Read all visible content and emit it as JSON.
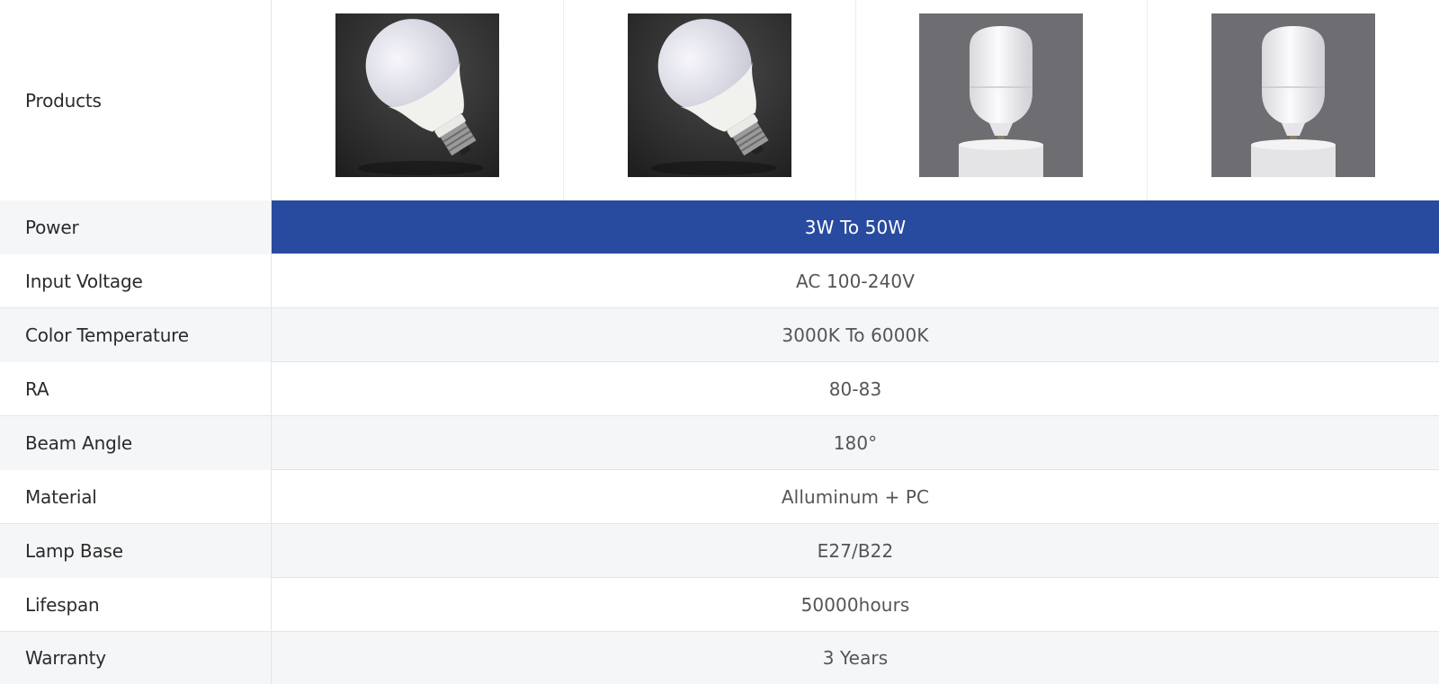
{
  "header": {
    "label": "Products",
    "products": [
      {
        "icon": "a-shape-led-bulb-photo"
      },
      {
        "icon": "a-shape-led-bulb-photo"
      },
      {
        "icon": "t-shape-led-bulb-photo"
      },
      {
        "icon": "t-shape-led-bulb-photo"
      }
    ]
  },
  "specs": [
    {
      "label": "Power",
      "value": "3W To 50W"
    },
    {
      "label": "Input Voltage",
      "value": "AC 100-240V"
    },
    {
      "label": "Color Temperature",
      "value": "3000K To 6000K"
    },
    {
      "label": "RA",
      "value": "80-83"
    },
    {
      "label": "Beam Angle",
      "value": "180°"
    },
    {
      "label": "Material",
      "value": "Alluminum + PC"
    },
    {
      "label": "Lamp Base",
      "value": "E27/B22"
    },
    {
      "label": "Lifespan",
      "value": "50000hours"
    },
    {
      "label": "Warranty",
      "value": "3 Years"
    }
  ],
  "colors": {
    "highlight": "#284ba0",
    "row_alt": "#f5f6f8",
    "border": "#e3e5e8"
  }
}
